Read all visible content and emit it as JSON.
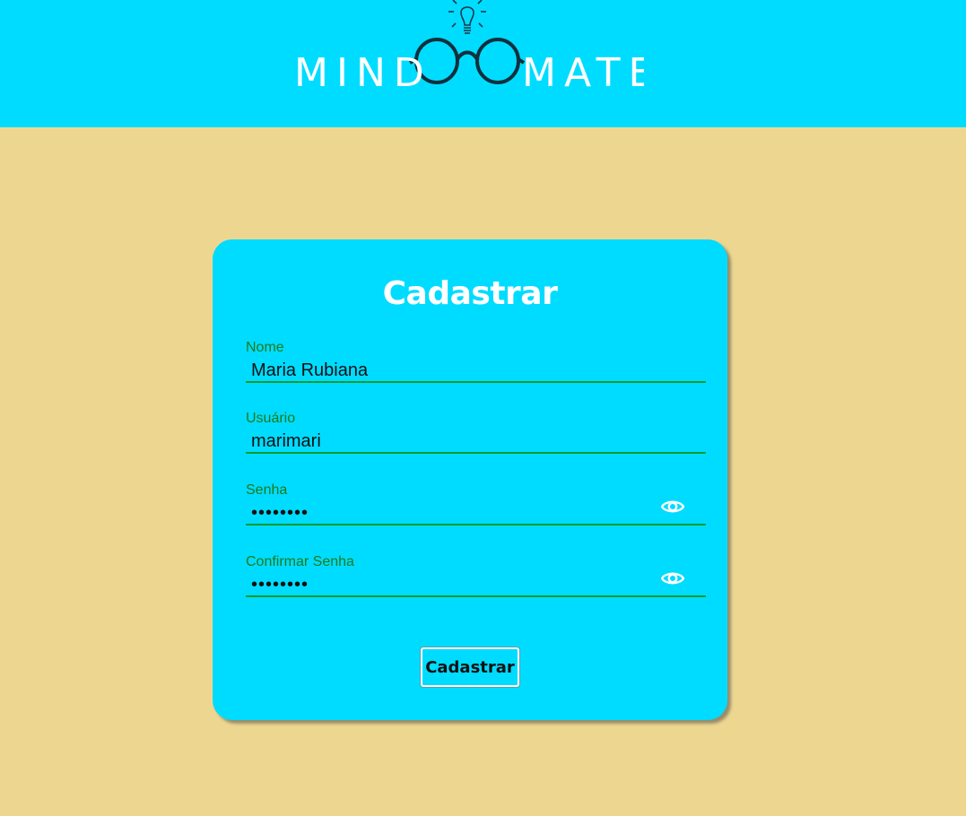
{
  "header": {
    "logo_word_left": "MIND",
    "logo_word_right": "MATE",
    "background_color": "#00dcff"
  },
  "page": {
    "background_color": "#edd790"
  },
  "form": {
    "title": "Cadastrar",
    "fields": [
      {
        "label": "Nome",
        "value": "Maria Rubiana"
      },
      {
        "label": "Usuário",
        "value": "marimari"
      },
      {
        "label": "Senha",
        "value": "••••••••",
        "toggle_icon": "eye-icon"
      },
      {
        "label": "Confirmar Senha",
        "value": "••••••••",
        "toggle_icon": "eye-icon"
      }
    ],
    "submit_label": "Cadastrar",
    "accent_color": "#0a9a2a"
  }
}
